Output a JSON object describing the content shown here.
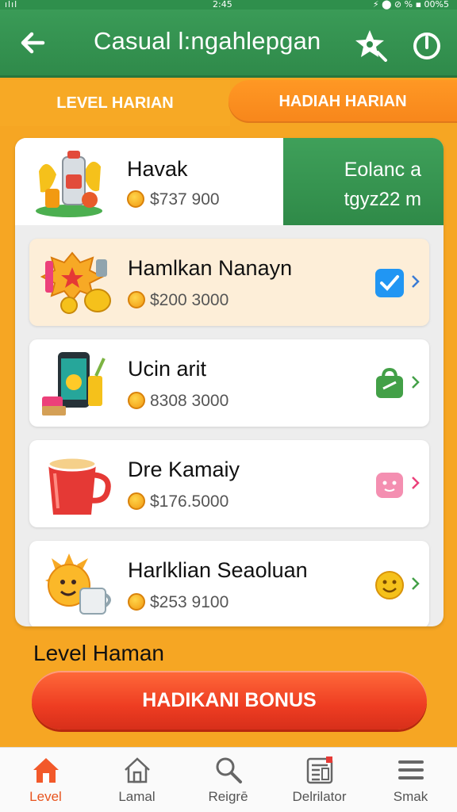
{
  "status_bar": {
    "left": "ılıl",
    "time": "2:45",
    "right": "⚡ ⬤ ⊘ % ▪ 00%5"
  },
  "app_bar": {
    "title": "Casual l:ngahlepgan"
  },
  "tabs": [
    {
      "label": "LEVEL HARIAN",
      "active": false
    },
    {
      "label": "HADIAH HARIAN",
      "active": true
    }
  ],
  "featured": {
    "name": "Havak",
    "price": "$737 900",
    "side_line1": "Eolanc a",
    "side_line2": "tgyz22 m"
  },
  "items": [
    {
      "name": "Hamlkan Nanayn",
      "price": "$200 3000",
      "highlighted": true,
      "badge": "check-badge-icon"
    },
    {
      "name": "Ucin arit",
      "price": "8308 3000",
      "highlighted": false,
      "badge": "bag-badge-icon"
    },
    {
      "name": "Dre Kamaiy",
      "price": "$176.5000",
      "highlighted": false,
      "badge": "pink-box-badge-icon"
    },
    {
      "name": "Harlklian Seaoluan",
      "price": "$253 9100",
      "highlighted": false,
      "badge": "smile-badge-icon"
    }
  ],
  "section_title": "Level Haman",
  "bonus_button": "HADIKANI BONUS",
  "bottom_nav": [
    {
      "label": "Level",
      "icon": "home-icon",
      "active": true
    },
    {
      "label": "Lamal",
      "icon": "house-outline-icon",
      "active": false
    },
    {
      "label": "Reigrē",
      "icon": "search-icon",
      "active": false
    },
    {
      "label": "Delrilator",
      "icon": "calendar-icon",
      "active": false
    },
    {
      "label": "Smak",
      "icon": "menu-icon",
      "active": false
    }
  ],
  "colors": {
    "brand_green": "#2f8a4a",
    "accent_orange": "#f7a925",
    "bonus_red": "#ee3d22",
    "nav_active": "#e8541e"
  }
}
